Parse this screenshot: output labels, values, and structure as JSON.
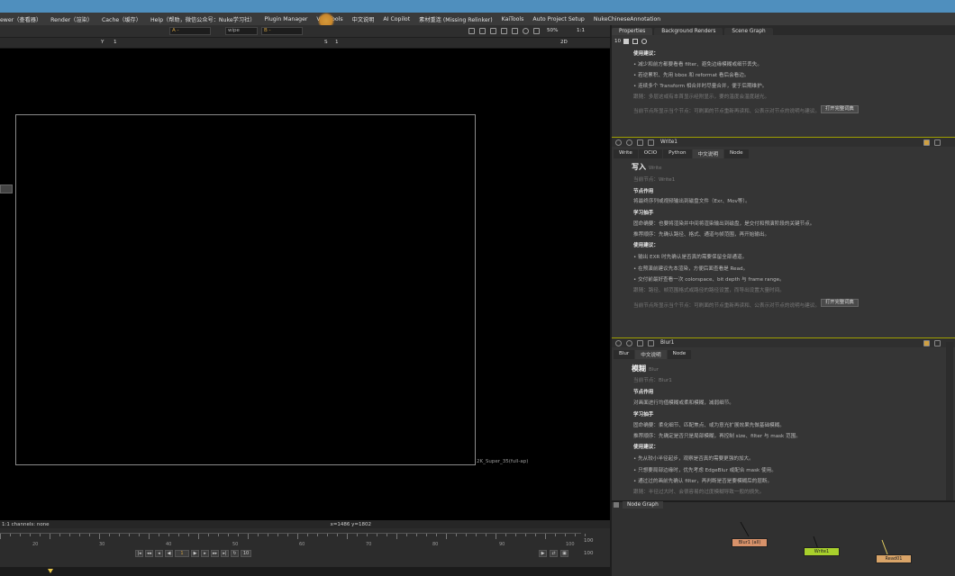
{
  "menubar": {
    "items": [
      "ewer（查看器）",
      "Render（渲染）",
      "Cache（缓存）",
      "Help（帮助，微信公众号：Nuke学习社）",
      "Plugin Manager",
      "VFX Tools",
      "中文说明",
      "AI Copilot",
      "素材重连 (Missing Relinker)",
      "KaiTools",
      "Auto Project Setup",
      "NukeChineseAnnotation"
    ]
  },
  "viewer": {
    "toolbar": {
      "channel_a": "A -",
      "wipe": "wipe",
      "channel_b": "B -",
      "zoom": "50%",
      "ratio": "1:1",
      "frame_left": "1",
      "y_label": "Y",
      "y_value": "1",
      "s_label": "S",
      "s_value": "1",
      "mode": "2D"
    },
    "format_label": "2K_Super_35(full-ap)",
    "info_left": "1:1 channels: none",
    "info_coords": "x=1486 y=1802",
    "timeline": {
      "ticks": [
        "20",
        "30",
        "40",
        "50",
        "60",
        "70",
        "80",
        "90",
        "100"
      ],
      "current_frame": "1",
      "step": "10",
      "end_frame": "100",
      "end_frame2": "100"
    }
  },
  "properties": {
    "tabs": [
      "Properties",
      "Background Renders",
      "Scene Graph"
    ],
    "count": "10",
    "top_section": {
      "heading": "使用建议：",
      "lines": [
        "• 减少和前方都要看看 filter、避免边缘模糊或细节丢失。",
        "• 若逆累积、先用 bbox 和 reformat 看后会看边。",
        "• 连续多个 Transform 相合并时尽量合并，便于后期维护。"
      ],
      "note": "跟随：多层这或有本首显示经附显示，要的温度会温度越光。",
      "footer": "当前节点所显示当个节点：可刷面的节点重新再读和、公表示对节点的说明与建议。",
      "button": "打开完整词典"
    },
    "write_node": {
      "name": "Write1",
      "tabs": [
        "Write",
        "OCIO",
        "Python",
        "中文说明",
        "Node"
      ],
      "title": "写入",
      "title_en": "Write",
      "current": "当前节点：Write1",
      "sec1": "节点作用",
      "sec1_text": "将最终序列或视频输出到磁盘文件（Exr、Mov等）。",
      "sec2": "学习抽手",
      "lines2": [
        "固命确要：也要将渲染并中间将渲染输出到磁盘，是交付和预演阶段的关键节点。",
        "推荐顺序：先确认路径、格式、通道与帧范围，再开始输出。"
      ],
      "sec3": "使用建议：",
      "lines3": [
        "• 输出 EXR 时先确认是否真的需要保留全部通道。",
        "• 在预演前建议先本渲染，方便后面查看是 Read。",
        "• 交付前最好查看一次 colorspace、bit depth 与 frame range。"
      ],
      "note": "跟随：路径、帧范围格式或路径的路径设置，而导出设置大量时间。",
      "footer": "当前节点所显示当个节点：可刷面的节点重新再读和、公表示对节点的说明与建议。",
      "button": "打开完整词典"
    },
    "blur_node": {
      "name": "Blur1",
      "tabs": [
        "Blur",
        "中文说明",
        "Node"
      ],
      "title": "模糊",
      "title_en": "Blur",
      "current": "当前节点：Blur1",
      "sec1": "节点作用",
      "sec1_text": "对画面进行均值模糊或柔和模糊，减弱细节。",
      "sec2": "学习抽手",
      "lines2": [
        "固命确要：柔化细节、匹配焦点、或为意光扩展效果先做基础模糊。",
        "推荐顺序：先确定是否只是局部模糊，再控制 size、filter 与 mask 范围。"
      ],
      "sec3": "使用建议：",
      "lines3": [
        "• 先从较小半径起步，观察是否真的需要更强的加大。",
        "• 只想要局部边缘时，优先考虑 EdgeBlur 或配合 mask 使用。",
        "• 通过过的画前先确认 filter，再判断是否是要模糊后的层断。"
      ],
      "note": "跟随：半径过大时、会很容易的过度模糊导致一般的损失。"
    }
  },
  "nodegraph": {
    "tab": "Node Graph",
    "nodes": [
      {
        "label": "Blur1",
        "sub": "(all)",
        "color": "#d8926a"
      },
      {
        "label": "Write1",
        "color": "#a8d02c"
      },
      {
        "label": "Read01",
        "color": "#d9a468"
      }
    ]
  },
  "colors": {
    "menubar": "#3a3a3a",
    "top_strip": "#4f8fbe",
    "panel": "#353535",
    "node_header_accent": "#a0a000"
  }
}
